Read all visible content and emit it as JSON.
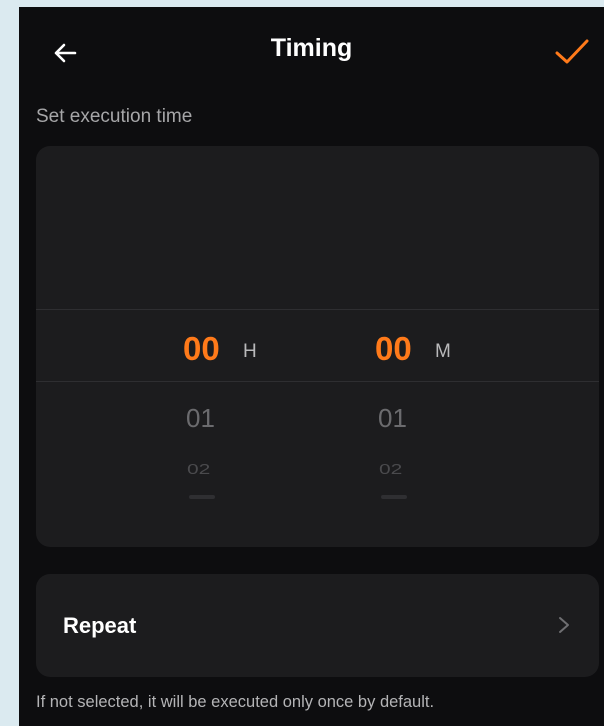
{
  "header": {
    "title": "Timing",
    "back_icon": "arrow-left-icon",
    "confirm_icon": "checkmark-icon"
  },
  "section_label": "Set execution time",
  "time_picker": {
    "hours": {
      "selected": "00",
      "unit": "H",
      "next1": "01",
      "next2": "02"
    },
    "minutes": {
      "selected": "00",
      "unit": "M",
      "next1": "01",
      "next2": "02"
    }
  },
  "repeat": {
    "label": "Repeat",
    "chevron_icon": "chevron-right-icon"
  },
  "footnote": "If not selected, it will be executed only once by default.",
  "colors": {
    "accent": "#ff7a1a",
    "background": "#0d0d0f",
    "card": "#1c1c1e",
    "outer": "#dbeaf0"
  }
}
